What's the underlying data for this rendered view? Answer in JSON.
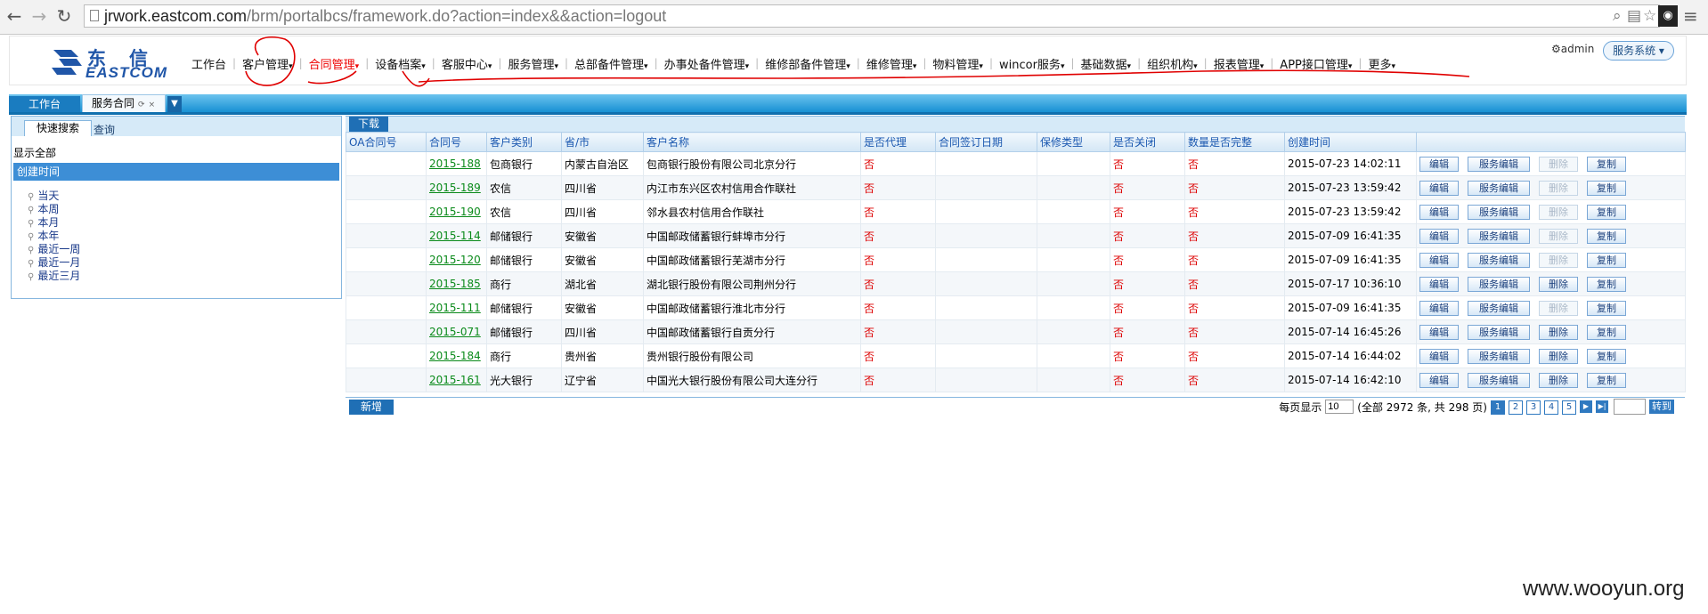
{
  "browser": {
    "url_host": "jrwork.eastcom.com",
    "url_path": "/brm/portalbcs/framework.do?action=index&&action=logout"
  },
  "logo": {
    "cn": "东信",
    "en": "EASTCOM"
  },
  "nav": [
    {
      "label": "工作台",
      "active": false
    },
    {
      "label": "客户管理",
      "active": false
    },
    {
      "label": "合同管理",
      "active": true
    },
    {
      "label": "设备档案",
      "active": false
    },
    {
      "label": "客服中心",
      "active": false
    },
    {
      "label": "服务管理",
      "active": false
    },
    {
      "label": "总部备件管理",
      "active": false
    },
    {
      "label": "办事处备件管理",
      "active": false
    },
    {
      "label": "维修部备件管理",
      "active": false
    },
    {
      "label": "维修管理",
      "active": false
    },
    {
      "label": "物料管理",
      "active": false
    },
    {
      "label": "wincor服务",
      "active": false
    },
    {
      "label": "基础数据",
      "active": false
    },
    {
      "label": "组织机构",
      "active": false
    },
    {
      "label": "报表管理",
      "active": false
    },
    {
      "label": "APP接口管理",
      "active": false
    },
    {
      "label": "更多",
      "active": false
    }
  ],
  "nav_arrow": "▾",
  "user": {
    "name": "admin",
    "service_menu": "服务系统"
  },
  "tabs": {
    "home": "工作台",
    "contract": "服务合同"
  },
  "left": {
    "tab_quick": "快速搜索",
    "tab_query": "查询",
    "show_all": "显示全部",
    "group": "创建时间",
    "items": [
      "当天",
      "本周",
      "本月",
      "本年",
      "最近一周",
      "最近一月",
      "最近三月"
    ]
  },
  "grid": {
    "download": "下载",
    "new": "新增",
    "columns": [
      "OA合同号",
      "合同号",
      "客户类别",
      "省/市",
      "客户名称",
      "是否代理",
      "合同签订日期",
      "保修类型",
      "是否关闭",
      "数量是否完整",
      "创建时间",
      ""
    ],
    "ops": {
      "edit": "编辑",
      "svc_edit": "服务编辑",
      "delete": "删除",
      "copy": "复制"
    },
    "rows": [
      {
        "oa": "",
        "no": "2015-188",
        "type": "包商银行",
        "prov": "内蒙古自治区",
        "cust": "包商银行股份有限公司北京分行",
        "agent": "否",
        "sign": "",
        "warr": "",
        "closed": "否",
        "complete": "否",
        "created": "2015-07-23 14:02:11",
        "del_disabled": true
      },
      {
        "oa": "",
        "no": "2015-189",
        "type": "农信",
        "prov": "四川省",
        "cust": "内江市东兴区农村信用合作联社",
        "agent": "否",
        "sign": "",
        "warr": "",
        "closed": "否",
        "complete": "否",
        "created": "2015-07-23 13:59:42",
        "del_disabled": true
      },
      {
        "oa": "",
        "no": "2015-190",
        "type": "农信",
        "prov": "四川省",
        "cust": "邻水县农村信用合作联社",
        "agent": "否",
        "sign": "",
        "warr": "",
        "closed": "否",
        "complete": "否",
        "created": "2015-07-23 13:59:42",
        "del_disabled": true
      },
      {
        "oa": "",
        "no": "2015-114",
        "type": "邮储银行",
        "prov": "安徽省",
        "cust": "中国邮政储蓄银行蚌埠市分行",
        "agent": "否",
        "sign": "",
        "warr": "",
        "closed": "否",
        "complete": "否",
        "created": "2015-07-09 16:41:35",
        "del_disabled": true
      },
      {
        "oa": "",
        "no": "2015-120",
        "type": "邮储银行",
        "prov": "安徽省",
        "cust": "中国邮政储蓄银行芜湖市分行",
        "agent": "否",
        "sign": "",
        "warr": "",
        "closed": "否",
        "complete": "否",
        "created": "2015-07-09 16:41:35",
        "del_disabled": true
      },
      {
        "oa": "",
        "no": "2015-185",
        "type": "商行",
        "prov": "湖北省",
        "cust": "湖北银行股份有限公司荆州分行",
        "agent": "否",
        "sign": "",
        "warr": "",
        "closed": "否",
        "complete": "否",
        "created": "2015-07-17 10:36:10",
        "del_disabled": false
      },
      {
        "oa": "",
        "no": "2015-111",
        "type": "邮储银行",
        "prov": "安徽省",
        "cust": "中国邮政储蓄银行淮北市分行",
        "agent": "否",
        "sign": "",
        "warr": "",
        "closed": "否",
        "complete": "否",
        "created": "2015-07-09 16:41:35",
        "del_disabled": true
      },
      {
        "oa": "",
        "no": "2015-071",
        "type": "邮储银行",
        "prov": "四川省",
        "cust": "中国邮政储蓄银行自贡分行",
        "agent": "否",
        "sign": "",
        "warr": "",
        "closed": "否",
        "complete": "否",
        "created": "2015-07-14 16:45:26",
        "del_disabled": false
      },
      {
        "oa": "",
        "no": "2015-184",
        "type": "商行",
        "prov": "贵州省",
        "cust": "贵州银行股份有限公司",
        "agent": "否",
        "sign": "",
        "warr": "",
        "closed": "否",
        "complete": "否",
        "created": "2015-07-14 16:44:02",
        "del_disabled": false
      },
      {
        "oa": "",
        "no": "2015-161",
        "type": "光大银行",
        "prov": "辽宁省",
        "cust": "中国光大银行股份有限公司大连分行",
        "agent": "否",
        "sign": "",
        "warr": "",
        "closed": "否",
        "complete": "否",
        "created": "2015-07-14 16:42:10",
        "del_disabled": false
      }
    ]
  },
  "pager": {
    "per_page_label": "每页显示",
    "per_page": "10",
    "summary": "(全部 2972 条, 共 298 页)",
    "pages": [
      "1",
      "2",
      "3",
      "4",
      "5"
    ],
    "current": "1",
    "next": "▶",
    "last": "▶|",
    "go": "转到"
  },
  "watermark": "www.wooyun.org",
  "annotation_color": "#e00000"
}
